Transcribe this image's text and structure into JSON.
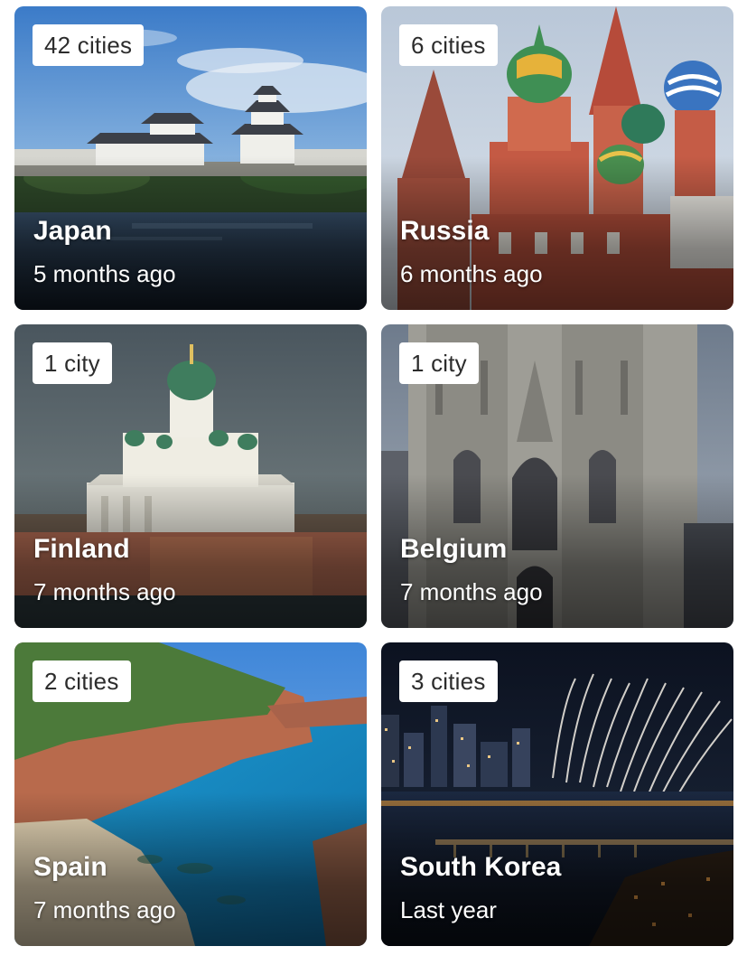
{
  "cards": [
    {
      "badge": "42 cities",
      "title": "Japan",
      "subtitle": "5 months ago"
    },
    {
      "badge": "6 cities",
      "title": "Russia",
      "subtitle": "6 months ago"
    },
    {
      "badge": "1 city",
      "title": "Finland",
      "subtitle": "7 months ago"
    },
    {
      "badge": "1 city",
      "title": "Belgium",
      "subtitle": "7 months ago"
    },
    {
      "badge": "2 cities",
      "title": "Spain",
      "subtitle": "7 months ago"
    },
    {
      "badge": "3 cities",
      "title": "South Korea",
      "subtitle": "Last year"
    }
  ],
  "colors": {
    "badge_background": "#ffffff",
    "badge_text": "#2c2c2c",
    "title_text": "#ffffff"
  }
}
